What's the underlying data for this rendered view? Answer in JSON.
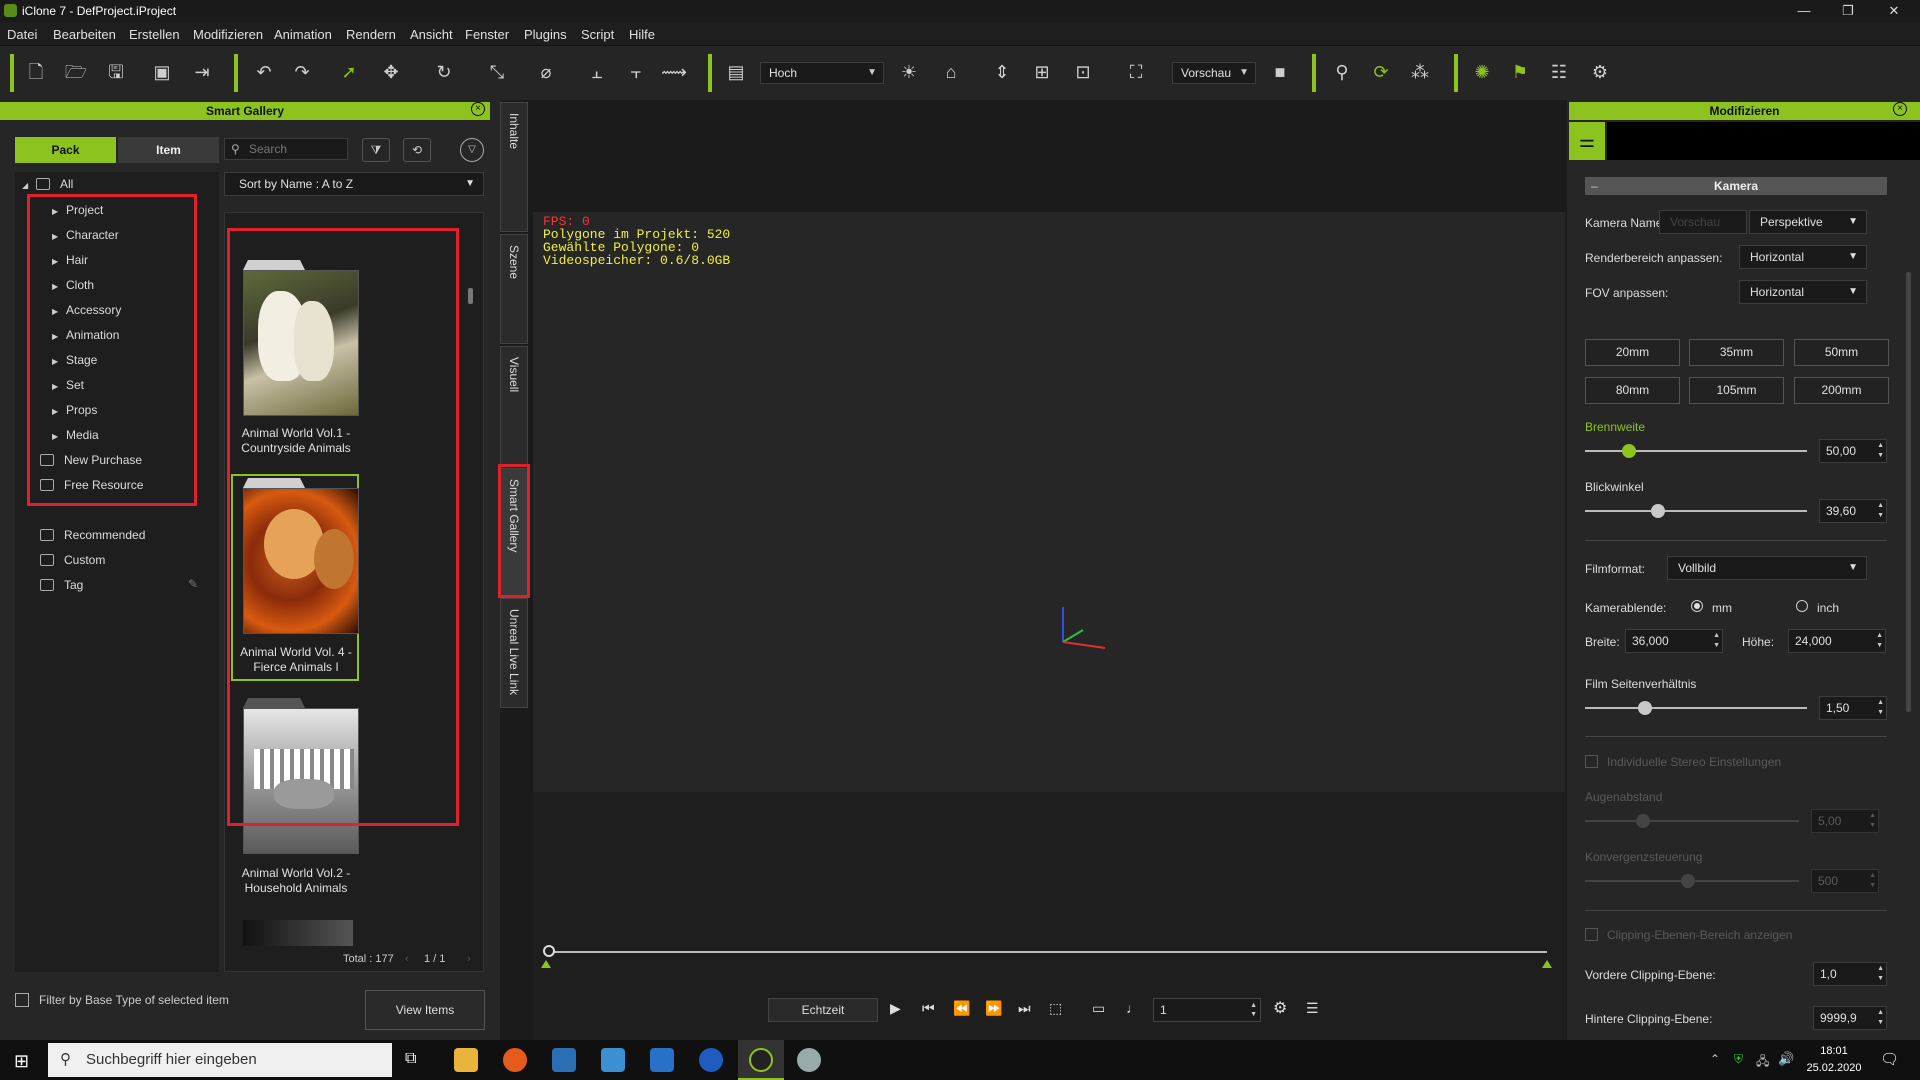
{
  "titlebar": {
    "title": "iClone 7 - DefProject.iProject"
  },
  "menubar": [
    "Datei",
    "Bearbeiten",
    "Erstellen",
    "Modifizieren",
    "Animation",
    "Rendern",
    "Ansicht",
    "Fenster",
    "Plugins",
    "Script",
    "Hilfe"
  ],
  "toolbar": {
    "view_combo": "Hoch",
    "preview_combo": "Vorschau"
  },
  "smart_gallery": {
    "title": "Smart Gallery",
    "tabs": [
      "Pack",
      "Item"
    ],
    "search_placeholder": "Search",
    "sort": "Sort by Name : A to Z",
    "tree_all": "All",
    "tree": [
      "Project",
      "Character",
      "Hair",
      "Cloth",
      "Accessory",
      "Animation",
      "Stage",
      "Set",
      "Props",
      "Media"
    ],
    "new_purchase": "New Purchase",
    "free_resource": "Free Resource",
    "recommended": "Recommended",
    "custom": "Custom",
    "tag": "Tag",
    "items": [
      {
        "line1": "Animal World  Vol.1 -",
        "line2": "Countryside Animals"
      },
      {
        "line1": "Animal World Vol. 4  -",
        "line2": "Fierce Animals I"
      },
      {
        "line1": "Animal World Vol.2 -",
        "line2": "Household Animals"
      }
    ],
    "total": "Total : 177",
    "page": "1  /  1",
    "filter_label": "Filter by Base Type of selected item",
    "view_items": "View Items"
  },
  "side_tabs": [
    "Inhalte",
    "Szene",
    "Visuell",
    "Smart Gallery",
    "Unreal Live Link"
  ],
  "viewport": {
    "fps": "FPS: 0",
    "polys": "Polygone im Projekt: 520",
    "selected": "Gewählte Polygone: 0",
    "vram": "Videospeicher: 0.6/8.0GB"
  },
  "playback": {
    "mode": "Echtzeit",
    "frame": "1"
  },
  "modify": {
    "title": "Modifizieren",
    "section": "Kamera",
    "camera_name_label": "Kamera Name:",
    "camera_name_placeholder": "Vorschau",
    "projection": "Perspektive",
    "render_label": "Renderbereich anpassen:",
    "render_value": "Horizontal",
    "fov_label": "FOV anpassen:",
    "fov_value": "Horizontal",
    "lens": [
      "20mm",
      "35mm",
      "50mm",
      "80mm",
      "105mm",
      "200mm"
    ],
    "focal_label": "Brennweite",
    "focal_value": "50,00",
    "angle_label": "Blickwinkel",
    "angle_value": "39,60",
    "film_label": "Filmformat:",
    "film_value": "Vollbild",
    "aperture_label": "Kamerablende:",
    "unit_mm": "mm",
    "unit_inch": "inch",
    "width_label": "Breite:",
    "width_value": "36,000",
    "height_label": "Höhe:",
    "height_value": "24,000",
    "ratio_label": "Film Seitenverhältnis",
    "ratio_value": "1,50",
    "stereo_label": "Individuelle Stereo Einstellungen",
    "eye_label": "Augenabstand",
    "eye_value": "5,00",
    "conv_label": "Konvergenzsteuerung",
    "conv_value": "500",
    "clip_label": "Clipping-Ebenen-Bereich anzeigen",
    "near_label": "Vordere Clipping-Ebene:",
    "near_value": "1,0",
    "far_label": "Hintere Clipping-Ebene:",
    "far_value": "9999,9"
  },
  "taskbar": {
    "search": "Suchbegriff hier eingeben",
    "time": "18:01",
    "date": "25.02.2020"
  },
  "colors": {
    "accent": "#8cc31f",
    "highlight": "#e0202a"
  }
}
